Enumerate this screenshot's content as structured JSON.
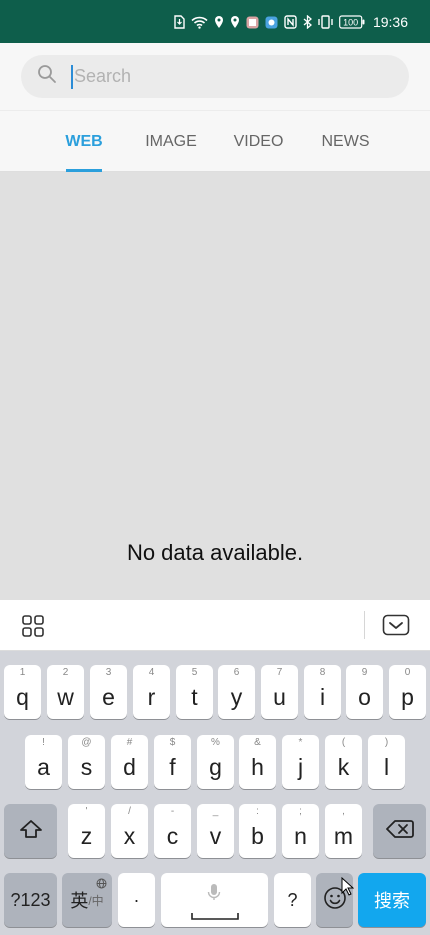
{
  "status_bar": {
    "time": "19:36",
    "battery": "100",
    "icons": [
      "sim-download-icon",
      "wifi-icon",
      "location-icon",
      "location-icon",
      "app-notification-icon",
      "app-notification-icon",
      "nfc-icon",
      "bluetooth-icon",
      "vibrate-icon",
      "battery-icon"
    ]
  },
  "search": {
    "placeholder": "Search",
    "value": ""
  },
  "tabs": [
    {
      "label": "WEB",
      "active": true
    },
    {
      "label": "IMAGE",
      "active": false
    },
    {
      "label": "VIDEO",
      "active": false
    },
    {
      "label": "NEWS",
      "active": false
    }
  ],
  "content": {
    "empty_message": "No data available."
  },
  "keyboard": {
    "toolbar": {
      "left_icon": "grid-icon",
      "right_icon": "keyboard-hide-icon"
    },
    "row1": [
      {
        "main": "q",
        "sub": "1"
      },
      {
        "main": "w",
        "sub": "2"
      },
      {
        "main": "e",
        "sub": "3"
      },
      {
        "main": "r",
        "sub": "4"
      },
      {
        "main": "t",
        "sub": "5"
      },
      {
        "main": "y",
        "sub": "6"
      },
      {
        "main": "u",
        "sub": "7"
      },
      {
        "main": "i",
        "sub": "8"
      },
      {
        "main": "o",
        "sub": "9"
      },
      {
        "main": "p",
        "sub": "0"
      }
    ],
    "row2": [
      {
        "main": "a",
        "sub": "!"
      },
      {
        "main": "s",
        "sub": "@"
      },
      {
        "main": "d",
        "sub": "#"
      },
      {
        "main": "f",
        "sub": "$"
      },
      {
        "main": "g",
        "sub": "%"
      },
      {
        "main": "h",
        "sub": "&"
      },
      {
        "main": "j",
        "sub": "*"
      },
      {
        "main": "k",
        "sub": "("
      },
      {
        "main": "l",
        "sub": ")"
      }
    ],
    "row3": [
      {
        "main": "z",
        "sub": "'"
      },
      {
        "main": "x",
        "sub": "/"
      },
      {
        "main": "c",
        "sub": "-"
      },
      {
        "main": "v",
        "sub": "_"
      },
      {
        "main": "b",
        "sub": ":"
      },
      {
        "main": "n",
        "sub": ";"
      },
      {
        "main": "m",
        "sub": ","
      }
    ],
    "bottom": {
      "symbols": "?123",
      "lang": "英",
      "lang_sub": "/中",
      "dot": "·",
      "question": "?",
      "search": "搜索"
    }
  },
  "colors": {
    "status_bar": "#0e5e4b",
    "accent": "#2b9fdc",
    "search_key": "#12a7ee"
  }
}
